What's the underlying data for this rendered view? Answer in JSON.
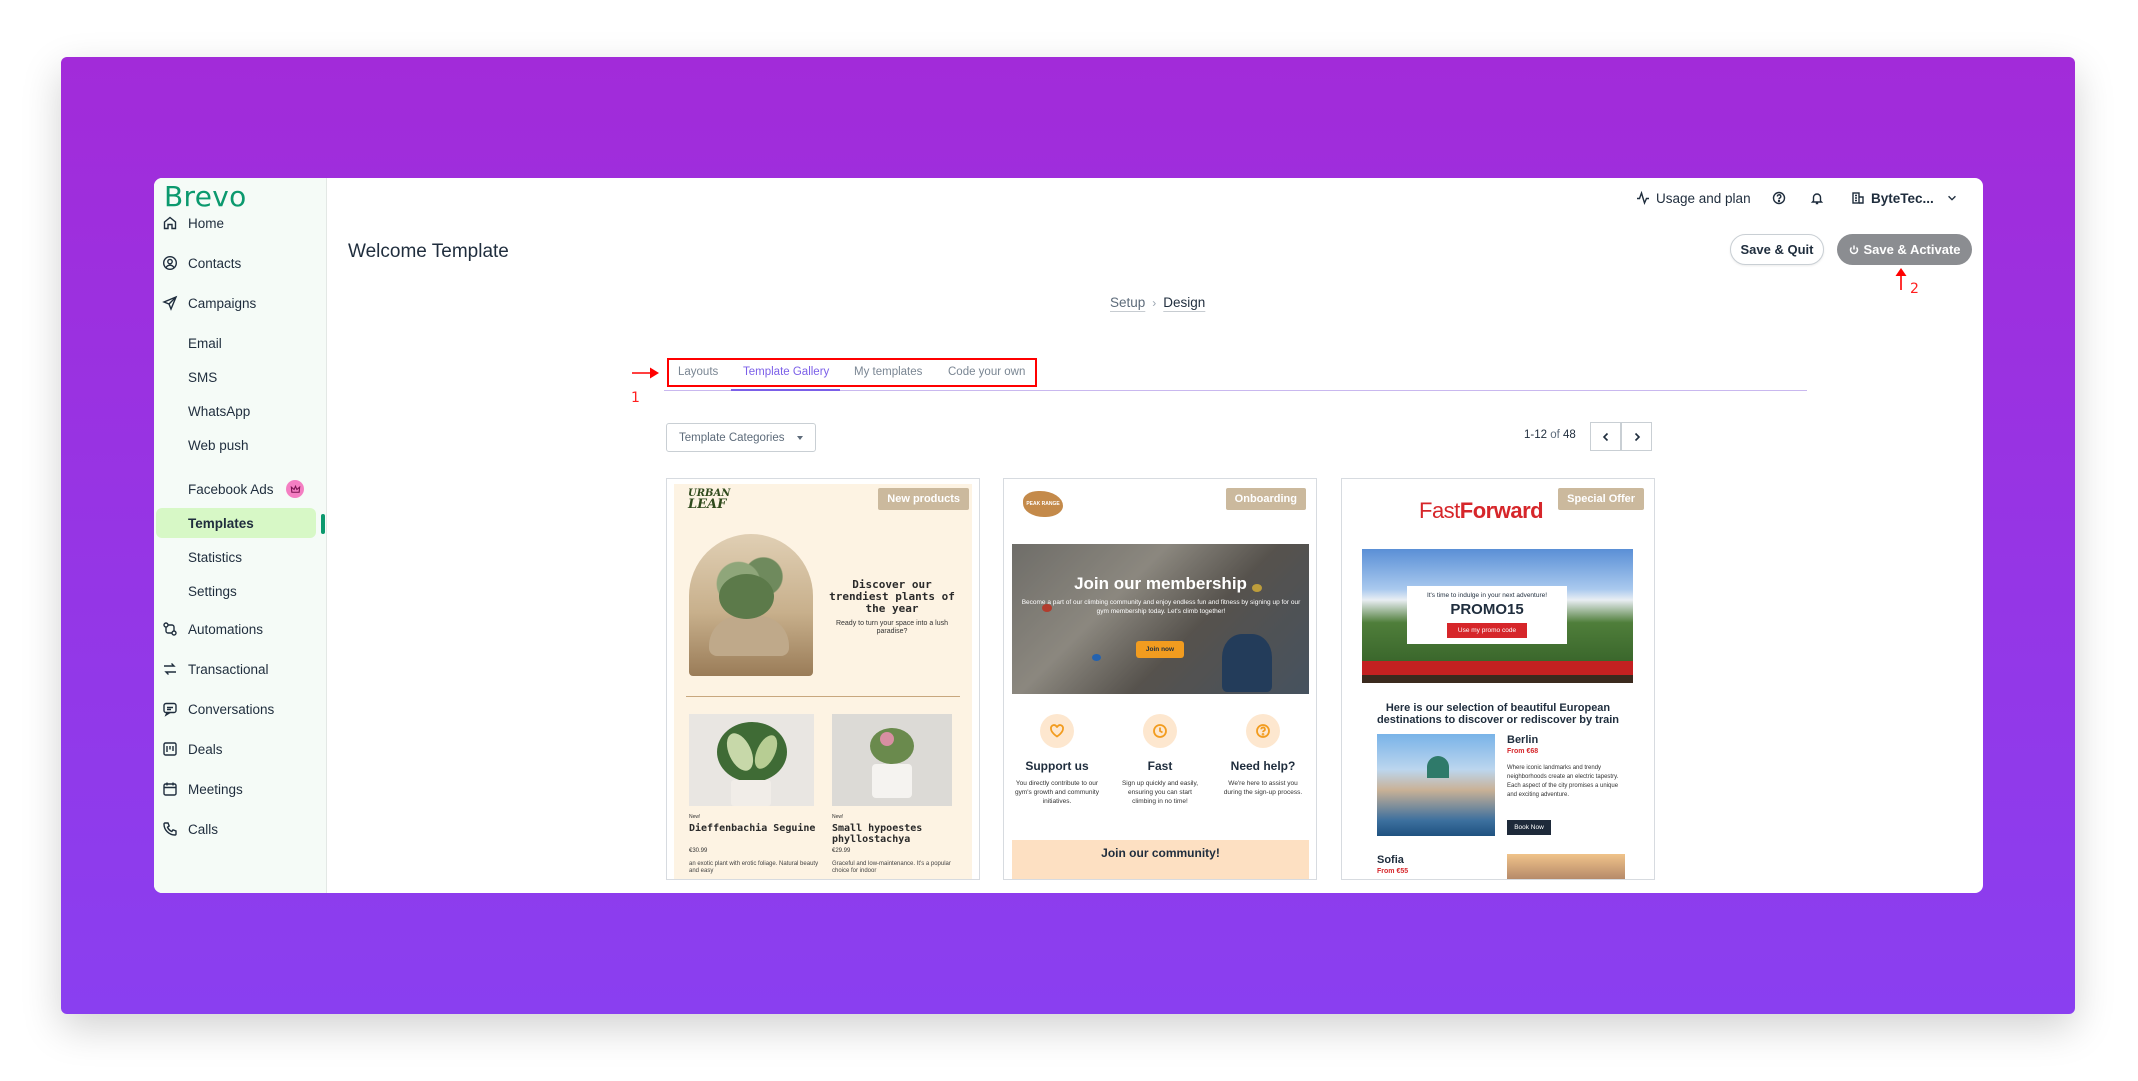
{
  "app": {
    "logo": "Brevo"
  },
  "sidebar": {
    "items": [
      {
        "label": "Home",
        "icon": "home-icon"
      },
      {
        "label": "Contacts",
        "icon": "contacts-icon"
      },
      {
        "label": "Campaigns",
        "icon": "send-icon"
      },
      {
        "label": "Automations",
        "icon": "automation-icon"
      },
      {
        "label": "Transactional",
        "icon": "transactional-icon"
      },
      {
        "label": "Conversations",
        "icon": "chat-icon"
      },
      {
        "label": "Deals",
        "icon": "deals-icon"
      },
      {
        "label": "Meetings",
        "icon": "calendar-icon"
      },
      {
        "label": "Calls",
        "icon": "phone-icon"
      }
    ],
    "campaign_sub": [
      "Email",
      "SMS",
      "WhatsApp",
      "Web push",
      "Facebook Ads",
      "Templates",
      "Statistics",
      "Settings"
    ],
    "active_sub": "Templates"
  },
  "topbar": {
    "usage": "Usage and plan",
    "account": "ByteTec..."
  },
  "page": {
    "title": "Welcome Template",
    "save_quit": "Save & Quit",
    "save_activate": "Save & Activate",
    "breadcrumb": {
      "step1": "Setup",
      "step2": "Design"
    }
  },
  "tabs": [
    "Layouts",
    "Template Gallery",
    "My templates",
    "Code your own"
  ],
  "active_tab": "Template Gallery",
  "markers": {
    "one": "1",
    "two": "2"
  },
  "filter": {
    "label": "Template Categories"
  },
  "pager": {
    "range": "1-12",
    "of": "of",
    "total": "48"
  },
  "cards": [
    {
      "tag": "New products",
      "brand_line1": "URBAN",
      "brand_line2": "LEAF",
      "headline": "Discover our trendiest plants of the year",
      "subline": "Ready to turn your space into a lush paradise?",
      "p1_new": "New!",
      "p1_name": "Dieffenbachia Seguine",
      "p1_price": "€30.99",
      "p1_desc": "an exotic plant with erotic foliage. Natural beauty and easy",
      "p2_new": "New!",
      "p2_name": "Small hypoestes phyllostachya",
      "p2_price": "€29.99",
      "p2_desc": "Graceful and low-maintenance. It's a popular choice for indoor"
    },
    {
      "tag": "Onboarding",
      "logo": "PEAK RANGE",
      "hero_title": "Join our membership",
      "hero_text": "Become a part of our climbing community and enjoy endless fun and fitness by signing up for our gym membership today. Let's climb together!",
      "hero_btn": "Join now",
      "f1_title": "Support us",
      "f1_text": "You directly contribute to our gym's growth and community initiatives.",
      "f2_title": "Fast",
      "f2_text": "Sign up quickly and easily, ensuring you can start climbing in no time!",
      "f3_title": "Need help?",
      "f3_text": "We're here to assist you during the sign-up process.",
      "footer": "Join our community!"
    },
    {
      "tag": "Special Offer",
      "brand_a": "Fast",
      "brand_b": "Forward",
      "promo_line": "It's time to indulge in your next adventure!",
      "promo_code": "PROMO15",
      "promo_btn": "Use my promo code",
      "section_title": "Here is our selection of beautiful European destinations to discover or rediscover by train",
      "city1": "Berlin",
      "city1_price": "From €68",
      "city1_desc": "Where iconic landmarks and trendy neighborhoods create an electric tapestry. Each aspect of the city promises a unique and exciting adventure.",
      "city1_btn": "Book Now",
      "city2": "Sofia",
      "city2_price": "From €55"
    }
  ],
  "colors": {
    "brand": "#0b996e",
    "accent_tab": "#7b5fe8",
    "annotation": "#ff0000",
    "frame": "#a22bd9"
  }
}
